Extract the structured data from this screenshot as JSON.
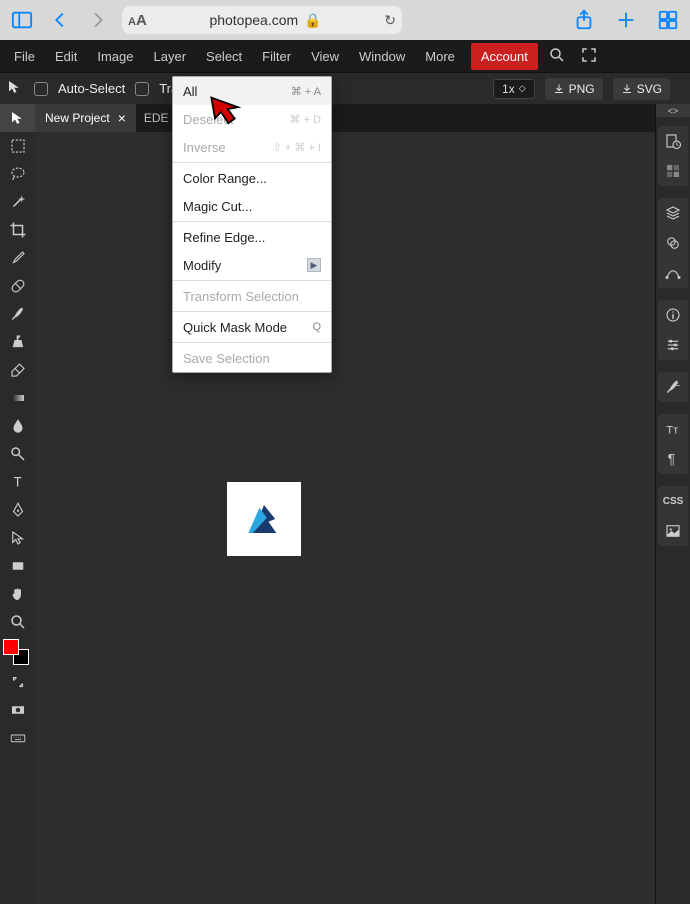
{
  "browser": {
    "url": "photopea.com"
  },
  "menu": {
    "file": "File",
    "edit": "Edit",
    "image": "Image",
    "layer": "Layer",
    "select": "Select",
    "filter": "Filter",
    "view": "View",
    "window": "Window",
    "more": "More",
    "account": "Account"
  },
  "opts": {
    "autoSelect": "Auto-Select",
    "transformControls": "Transform Controls",
    "zoom": "1x",
    "png": "PNG",
    "svg": "SVG"
  },
  "tabs": {
    "project": "New Project",
    "secondary": "EDE"
  },
  "dropdown": {
    "all": "All",
    "allShortcut": "⌘ + A",
    "deselect": "Deselect",
    "deselectShortcut": "⌘ + D",
    "inverse": "Inverse",
    "inverseShortcut": "⇧ + ⌘ + I",
    "colorRange": "Color Range...",
    "magicCut": "Magic Cut...",
    "refineEdge": "Refine Edge...",
    "modify": "Modify",
    "transform": "Transform Selection",
    "quickMask": "Quick Mask Mode",
    "quickMaskShortcut": "Q",
    "save": "Save Selection"
  },
  "panels": {
    "css": "CSS"
  },
  "code_badge": "<>"
}
